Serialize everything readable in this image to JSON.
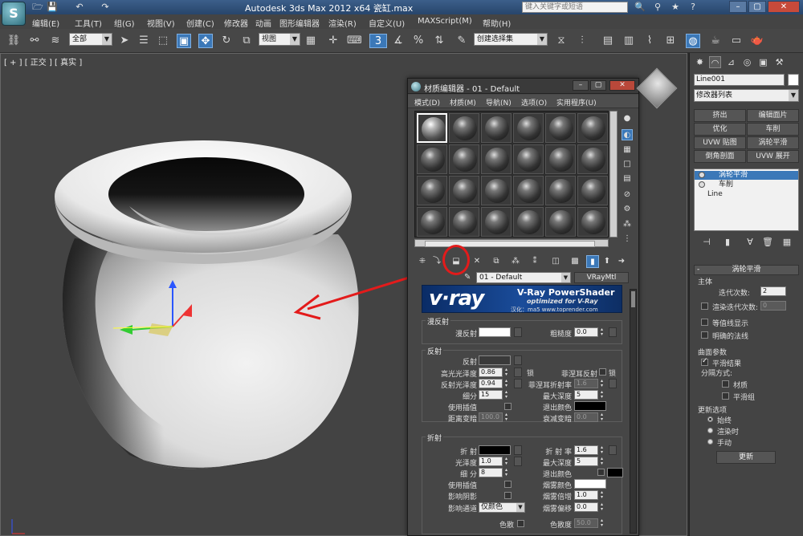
{
  "app": {
    "title": "Autodesk 3ds Max  2012 x64   瓷缸.max",
    "search_placeholder": "键入关键字或短语",
    "quick_access": [
      "🗁",
      "💾",
      "↶",
      "↷"
    ],
    "title_icons": [
      "🔍",
      "⚲",
      "★",
      "?"
    ],
    "window_buttons": [
      "–",
      "▢",
      "✕"
    ]
  },
  "menu": [
    "编辑(E)",
    "工具(T)",
    "组(G)",
    "视图(V)",
    "创建(C)",
    "修改器",
    "动画",
    "图形编辑器",
    "渲染(R)",
    "自定义(U)",
    "MAXScript(M)",
    "帮助(H)"
  ],
  "toolbar": {
    "selection_filter": "全部",
    "ref_coord": "视图",
    "named_selection": "创建选择集",
    "snap_label": "3"
  },
  "viewport": {
    "label": "[ + ] [ 正交 ] [ 真实 ]"
  },
  "command_panel": {
    "object_name": "Line001",
    "object_color": "#ffffff",
    "modifier_list": "修改器列表",
    "modifier_buttons": [
      "挤出",
      "编辑面片",
      "优化",
      "车削",
      "UVW 贴图",
      "涡轮平滑",
      "倒角剖面",
      "UVW 展开"
    ],
    "stack": [
      "涡轮平滑",
      "车削",
      "Line"
    ],
    "rollout_title": "涡轮平滑",
    "main_group": "主体",
    "iterations_label": "迭代次数:",
    "iterations": "2",
    "render_iters_label": "渲染迭代次数:",
    "render_iters": "0",
    "isoline_label": "等值线显示",
    "explicit_normals_label": "明确的法线",
    "surface_group": "曲面参数",
    "smooth_result_label": "平滑结果",
    "separate_label": "分隔方式:",
    "materials_label": "材质",
    "smoothing_groups_label": "平滑组",
    "update_group": "更新选项",
    "always_label": "始终",
    "when_rendering_label": "渲染时",
    "manually_label": "手动",
    "update_button": "更新"
  },
  "material_editor": {
    "title": "材质编辑器 - 01 - Default",
    "menu": [
      "模式(D)",
      "材质(M)",
      "导航(N)",
      "选项(O)",
      "实用程序(U)"
    ],
    "material_name": "01 - Default",
    "material_type": "VRayMtl",
    "banner": {
      "logo": "v·ray",
      "title": "V-Ray PowerShader",
      "subtitle": "optimized for V-Ray",
      "credit": "汉化：ma5 www.toprender.com"
    },
    "diffuse_section": "漫反射",
    "diffuse_label": "漫反射",
    "diffuse_color": "#ffffff",
    "roughness_label": "粗糙度",
    "roughness": "0.0",
    "reflection_section": "反射",
    "reflect_label": "反射",
    "reflect_color": "#3a3a3a",
    "hilight_gloss_label": "高光光泽度",
    "hilight_gloss": "0.86",
    "lock_label": "锁",
    "fresnel_label": "菲涅耳反射",
    "refl_gloss_label": "反射光泽度",
    "refl_gloss": "0.94",
    "fresnel_ior_label": "菲涅耳折射率",
    "fresnel_ior": "1.6",
    "subdivs_label": "细分",
    "subdivs": "15",
    "max_depth_label": "最大深度",
    "max_depth": "5",
    "use_interp_label": "使用插值",
    "exit_color_label": "退出颜色",
    "exit_color": "#000000",
    "dim_distance_label": "距离变暗",
    "dim_distance": "100.0",
    "dim_falloff_label": "衰减变暗",
    "dim_falloff": "0.0",
    "refraction_section": "折射",
    "refract_label": "折 射",
    "refract_color": "#000000",
    "ior_label": "折 射 率",
    "ior": "1.6",
    "glossiness_label": "光泽度",
    "glossiness": "1.0",
    "refr_max_depth_label": "最大深度",
    "refr_max_depth": "5",
    "refr_subdivs_label": "细 分",
    "refr_subdivs": "8",
    "refr_exit_label": "退出颜色",
    "refr_exit_color": "#000000",
    "refr_interp_label": "使用插值",
    "fog_color_label": "烟雾颜色",
    "fog_color": "#ffffff",
    "shadows_label": "影响阴影",
    "fog_mult_label": "烟雾倍增",
    "fog_mult": "1.0",
    "affect_channels_label": "影响通道",
    "affect_channels": "仅颜色",
    "fog_bias_label": "烟雾偏移",
    "fog_bias": "0.0",
    "dispersion_label": "色散",
    "abbe_label": "色散度",
    "abbe": "50.0"
  }
}
